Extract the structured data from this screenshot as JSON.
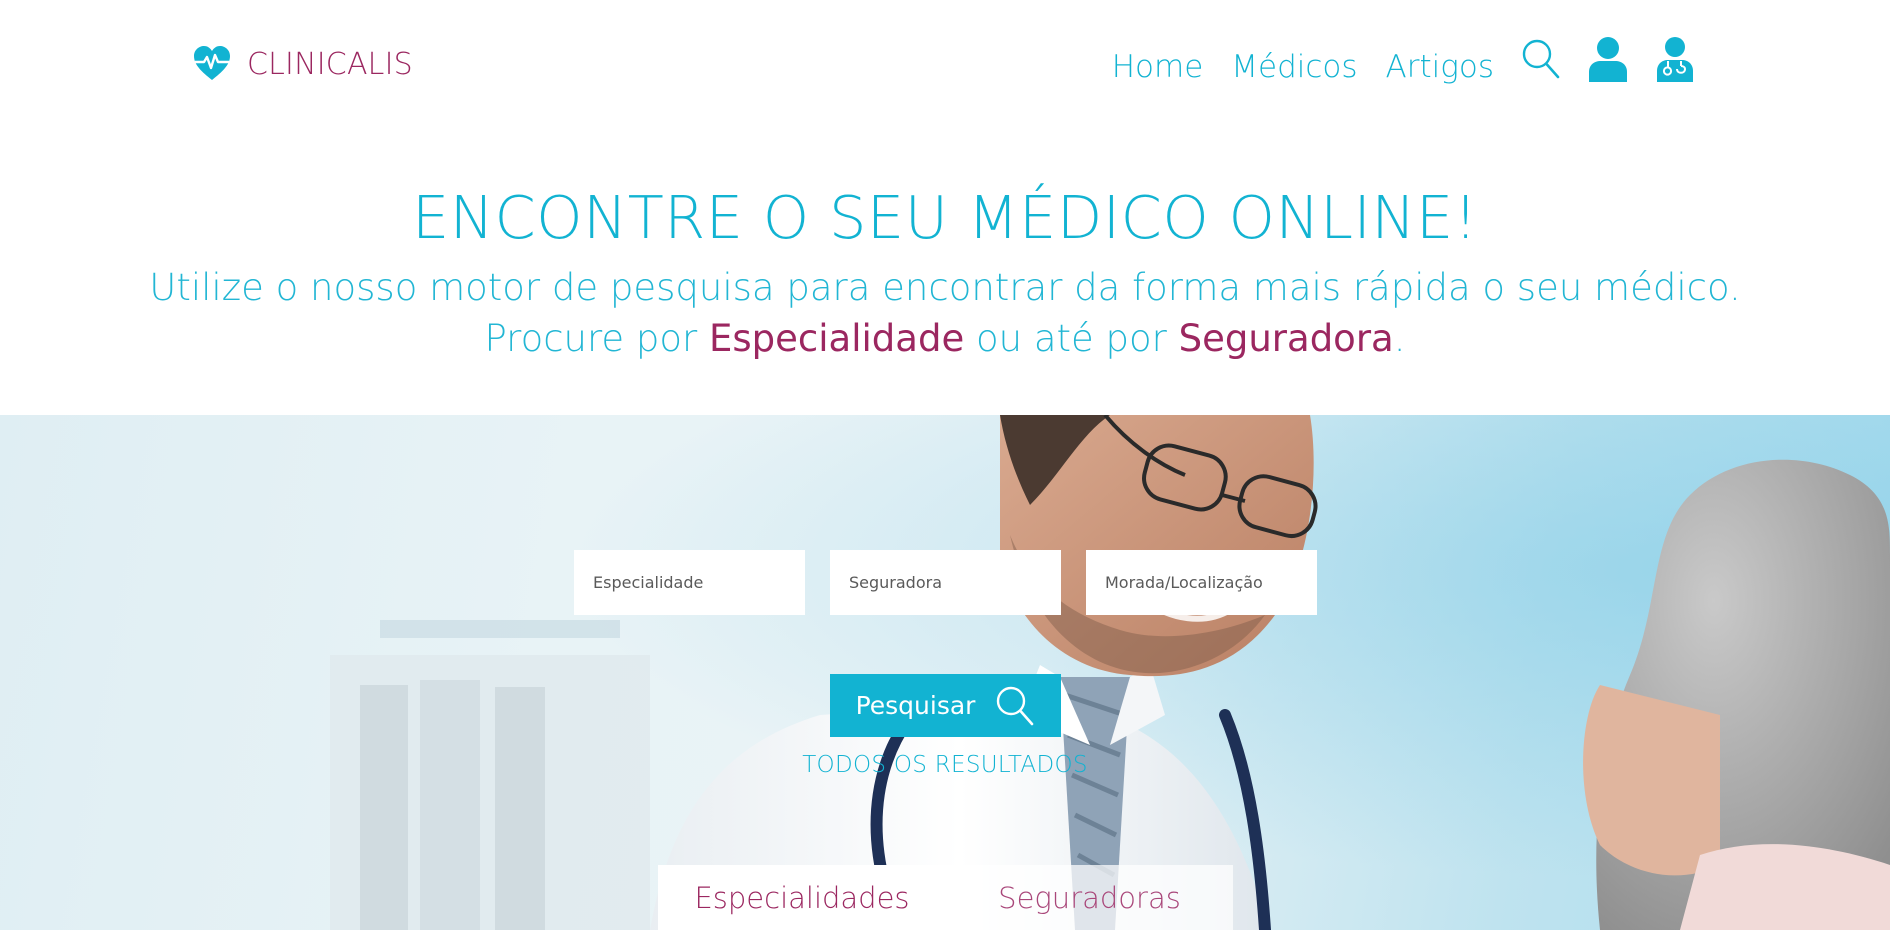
{
  "brand": {
    "name": "CLINICALIS",
    "icon": "heart-pulse-icon",
    "color": "#9b2760"
  },
  "nav": {
    "links": [
      {
        "label": "Home"
      },
      {
        "label": "Médicos"
      },
      {
        "label": "Artigos"
      }
    ],
    "icons": [
      "search-icon",
      "user-icon",
      "doctor-icon"
    ],
    "color": "#12b3d2"
  },
  "hero": {
    "title": "ENCONTRE O SEU MÉDICO ONLINE!",
    "line1": "Utilize o nosso motor de pesquisa para encontrar da forma mais rápida o seu médico.",
    "line2_prefix": "Procure por ",
    "line2_accent1": "Especialidade",
    "line2_middle": " ou até por ",
    "line2_accent2": "Seguradora",
    "line2_suffix": "."
  },
  "search": {
    "specialty_placeholder": "Especialidade",
    "insurer_placeholder": "Seguradora",
    "location_placeholder": "Morada/Localização",
    "button_label": "Pesquisar",
    "all_results": "TODOS OS RESULTADOS"
  },
  "tabs": [
    {
      "label": "Especialidades",
      "active": true
    },
    {
      "label": "Seguradoras",
      "active": false
    }
  ],
  "colors": {
    "accent": "#12b3d2",
    "brand": "#9b2760",
    "white": "#ffffff"
  }
}
